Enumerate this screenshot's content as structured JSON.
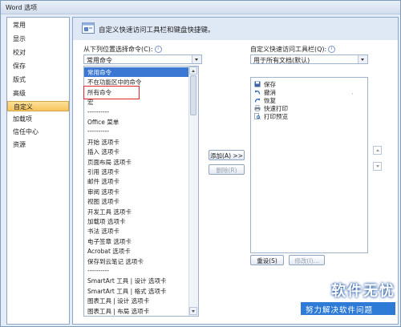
{
  "window": {
    "title": "Word 选项"
  },
  "nav": {
    "items": [
      "常用",
      "显示",
      "校对",
      "保存",
      "版式",
      "高级",
      "自定义",
      "加载项",
      "信任中心",
      "资源"
    ],
    "selected_index": 6
  },
  "header": {
    "text": "自定义快速访问工具栏和键盘快捷键。"
  },
  "left": {
    "label": "从下列位置选择命令(C):",
    "info": "i",
    "combo_value": "常用命令",
    "commands": [
      "常用命令",
      "不在功能区中的命令",
      "所有命令",
      "宏",
      "----------",
      "Office 菜单",
      "----------",
      "开始 选项卡",
      "插入 选项卡",
      "页面布局 选项卡",
      "引用 选项卡",
      "邮件 选项卡",
      "审阅 选项卡",
      "视图 选项卡",
      "开发工具 选项卡",
      "加载项 选项卡",
      "书法 选项卡",
      "电子签章 选项卡",
      "Acrobat 选项卡",
      "保存到云笔记 选项卡",
      "----------",
      "SmartArt 工具 | 设计 选项卡",
      "SmartArt 工具 | 格式 选项卡",
      "图表工具 | 设计 选项卡",
      "图表工具 | 布局 选项卡"
    ],
    "selected_index": 0,
    "highlighted_index": 2
  },
  "middle": {
    "add_label": "添加(A) >>",
    "remove_label": "删除(R)"
  },
  "right": {
    "label": "自定义快速访问工具栏(Q):",
    "info": "i",
    "combo_value": "用于所有文档(默认)",
    "items": [
      {
        "label": "保存",
        "icon": "save-icon"
      },
      {
        "label": "撤消",
        "icon": "undo-icon"
      },
      {
        "label": "恢复",
        "icon": "redo-icon"
      },
      {
        "label": "快速打印",
        "icon": "quick-print-icon"
      },
      {
        "label": "打印预览",
        "icon": "print-preview-icon"
      }
    ],
    "reset_label": "重设(S)",
    "modify_label": "修改(I)..."
  },
  "watermark": {
    "title": "软件无忧",
    "subtitle": "努力解决软件问题"
  },
  "colors": {
    "selection": "#3b78d4",
    "nav_selected": "#f7c35b",
    "highlight_box": "#e3262a"
  }
}
